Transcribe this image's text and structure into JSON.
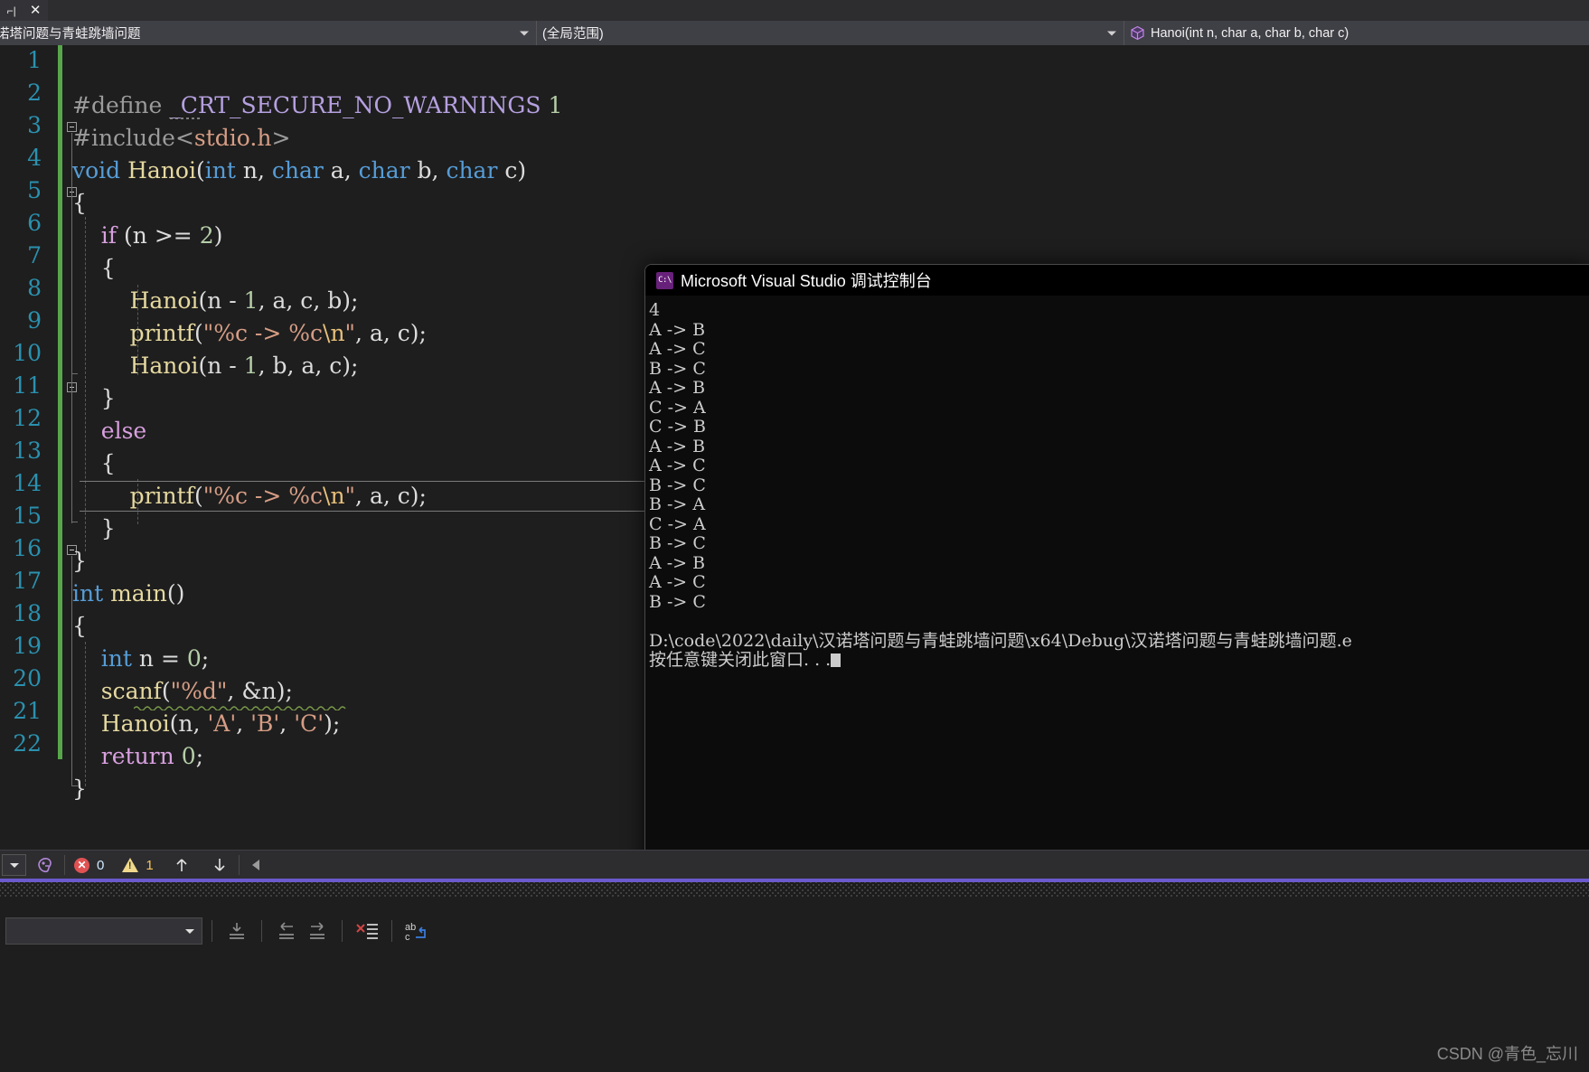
{
  "window": {
    "tab_pin_icon": "pin-icon",
    "tab_close_icon": "close-icon"
  },
  "navbar": {
    "file_combo_value": "诺塔问题与青蛙跳墙问题",
    "scope_combo_value": "(全局范围)",
    "member_combo_value": "Hanoi(int n, char a, char b, char c)",
    "member_icon": "method-cube-icon",
    "dropdown_icon": "chevron-down-icon"
  },
  "editor": {
    "line_numbers": [
      "1",
      "2",
      "3",
      "4",
      "5",
      "6",
      "7",
      "8",
      "9",
      "10",
      "11",
      "12",
      "13",
      "14",
      "15",
      "16",
      "17",
      "18",
      "19",
      "20",
      "21",
      "22"
    ],
    "code": [
      "#define _CRT_SECURE_NO_WARNINGS 1",
      "#include<stdio.h>",
      "void Hanoi(int n, char a, char b, char c)",
      "{",
      "    if (n >= 2)",
      "    {",
      "        Hanoi(n - 1, a, c, b);",
      "        printf(\"%c -> %c\\n\", a, c);",
      "        Hanoi(n - 1, b, a, c);",
      "    }",
      "    else",
      "    {",
      "        printf(\"%c -> %c\\n\", a, c);",
      "    }",
      "}",
      "int main()",
      "{",
      "    int n = 0;",
      "    scanf(\"%d\", &n);",
      "    Hanoi(n, 'A', 'B', 'C');",
      "    return 0;",
      "}"
    ],
    "current_line": 13,
    "colors": {
      "background": "#1e1e1e",
      "line_number": "#2b91af",
      "keyword": "#569cd6",
      "control_keyword": "#d8a0df",
      "function": "#e6d9a0",
      "string": "#d69d85",
      "number": "#b5cea8",
      "macro": "#b5a0e0",
      "preprocessor": "#9b9b9b",
      "change_bar": "#57a64a"
    }
  },
  "console": {
    "title": "Microsoft Visual Studio 调试控制台",
    "icon": "console-app-icon",
    "input_value": "4",
    "moves": [
      "A -> B",
      "A -> C",
      "B -> C",
      "A -> B",
      "C -> A",
      "C -> B",
      "A -> B",
      "A -> C",
      "B -> C",
      "B -> A",
      "C -> A",
      "B -> C",
      "A -> B",
      "A -> C",
      "B -> C"
    ],
    "exe_path_line": "D:\\code\\2022\\daily\\汉诺塔问题与青蛙跳墙问题\\x64\\Debug\\汉诺塔问题与青蛙跳墙问题.e",
    "close_prompt": "按任意键关闭此窗口. . ."
  },
  "statusbar": {
    "dropdown_icon": "chevron-down-icon",
    "intellicode_icon": "intellicode-icon",
    "error_icon": "error-circle-icon",
    "error_count": "0",
    "warning_icon": "warning-triangle-icon",
    "warning_count": "1",
    "prev_icon": "arrow-up-icon",
    "next_icon": "arrow-down-icon",
    "scroll_left_icon": "arrow-left-icon"
  },
  "bottom_toolbar": {
    "combo_value": "",
    "icons": [
      "indent-guide-icon",
      "outdent-icon",
      "indent-icon",
      "clear-list-icon",
      "wrap-text-icon"
    ]
  },
  "watermark": "CSDN @青色_忘川"
}
